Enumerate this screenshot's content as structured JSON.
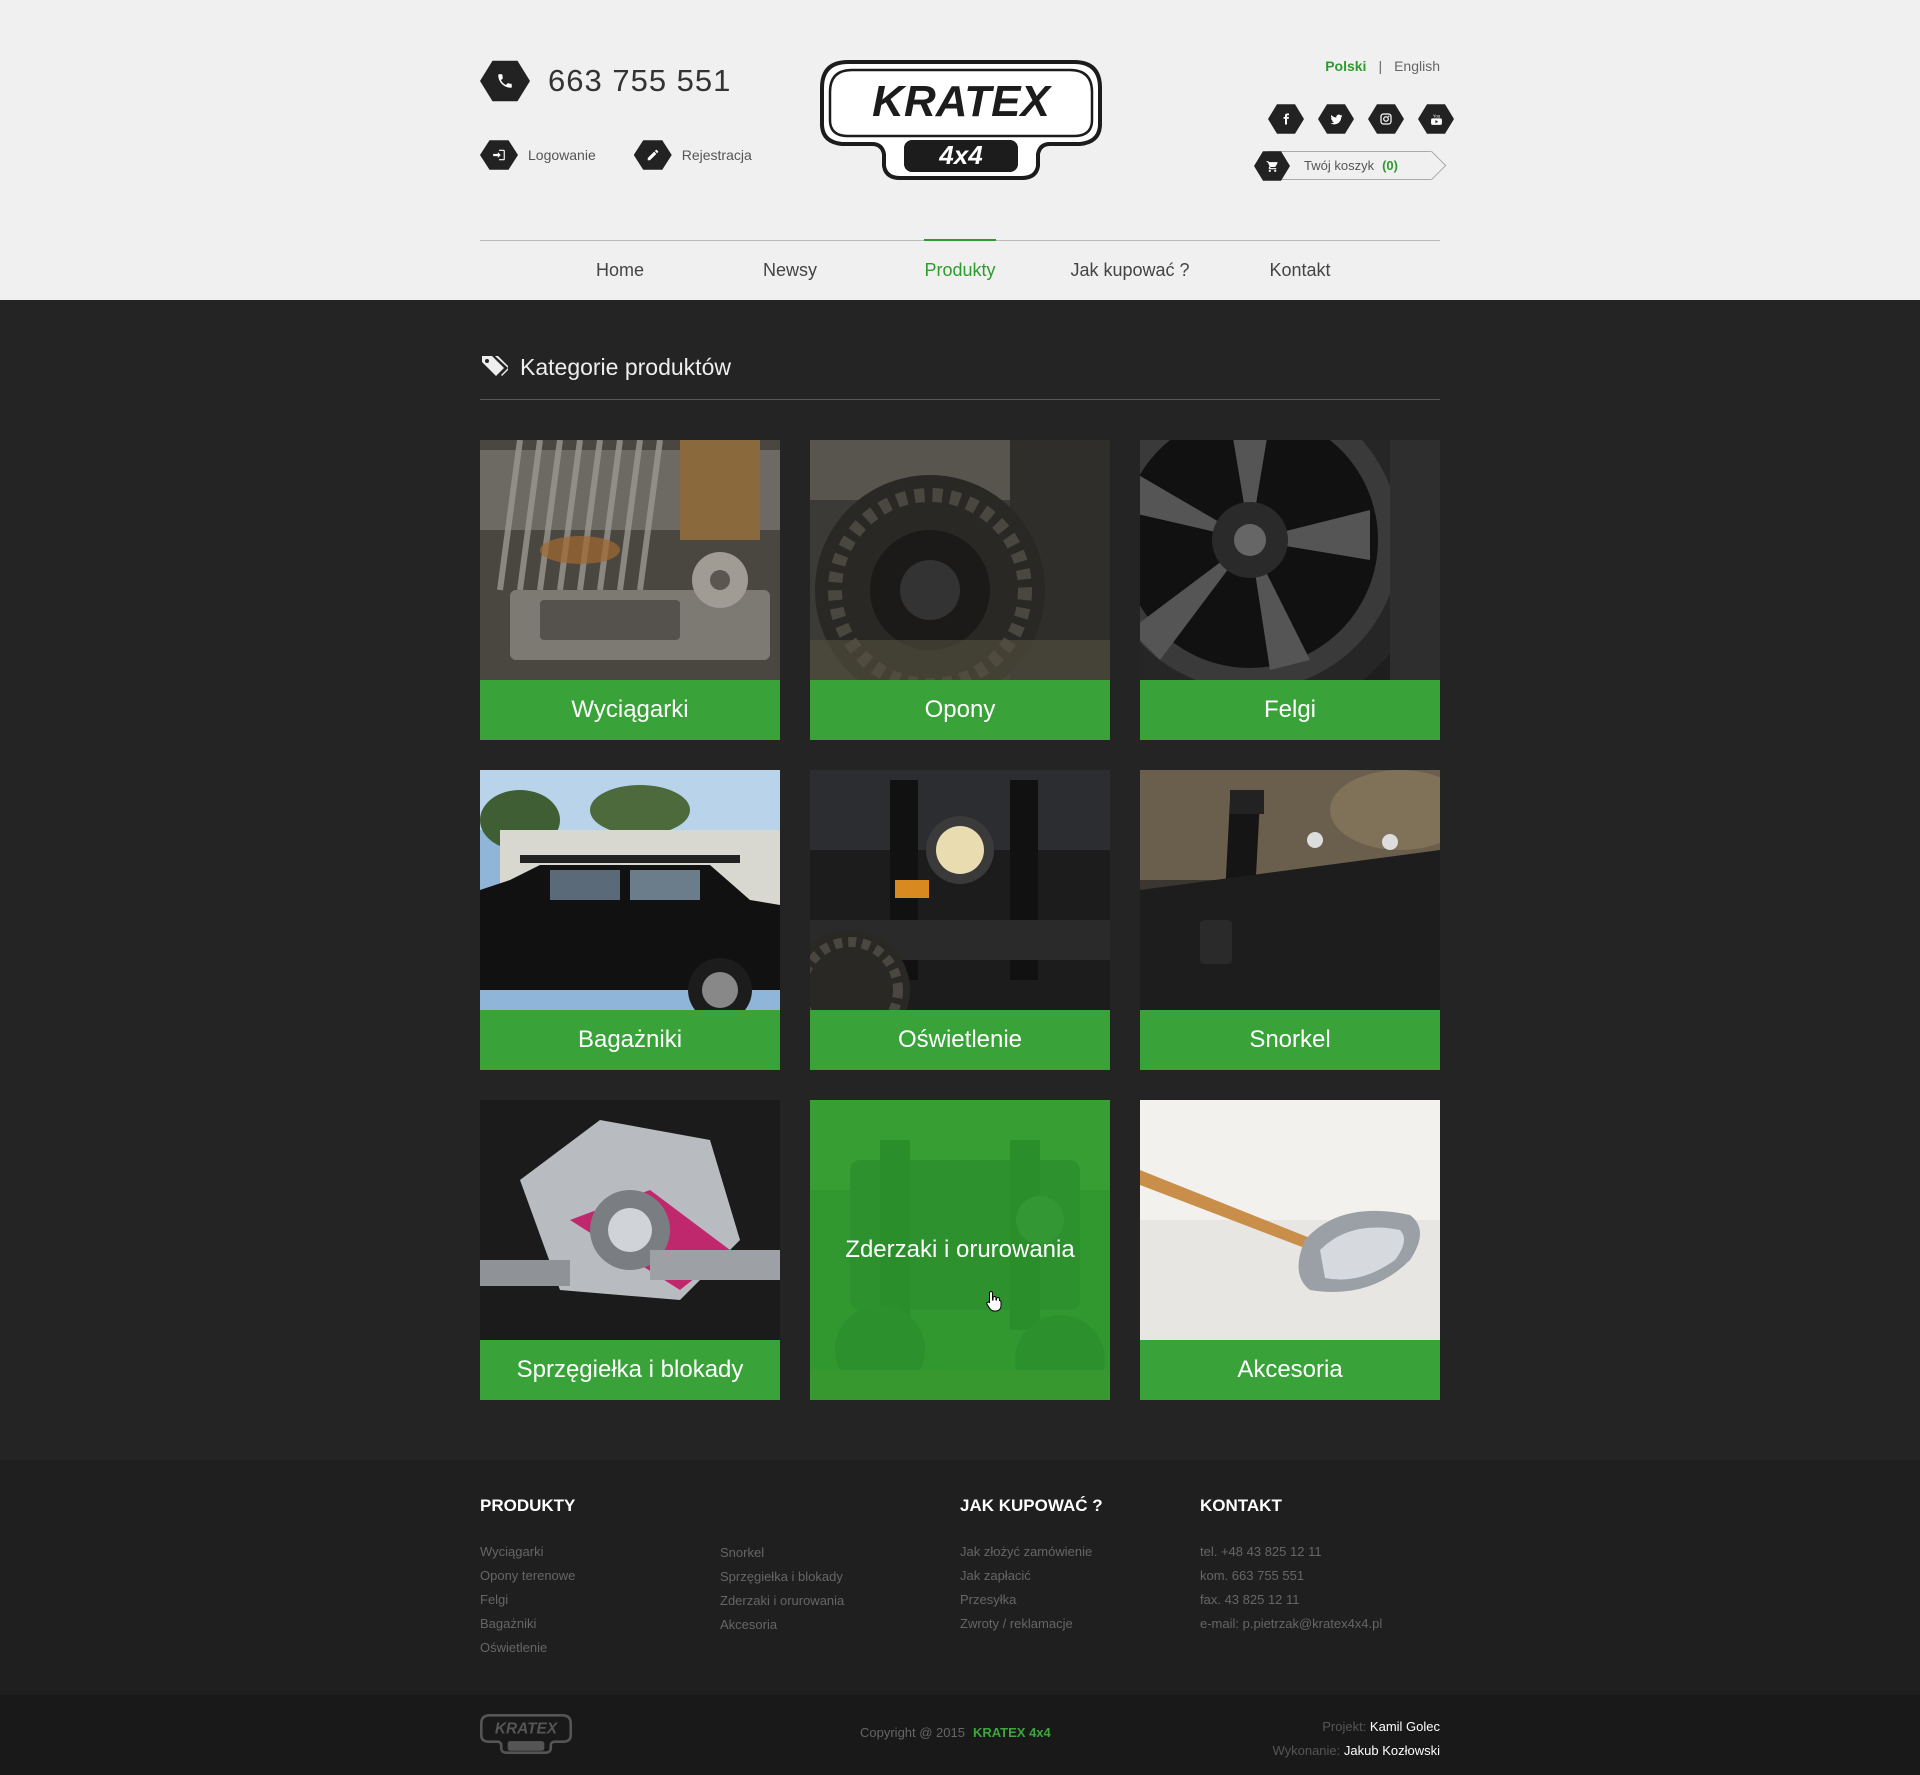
{
  "header": {
    "phone": "663  755  551",
    "auth": [
      {
        "label": "Logowanie",
        "icon": "login-icon"
      },
      {
        "label": "Rejestracja",
        "icon": "edit-icon"
      }
    ],
    "logo_text": "KRATEX",
    "logo_sub": "4x4",
    "languages": {
      "active": "Polski",
      "other": "English",
      "separator": "|"
    },
    "social": [
      "facebook-icon",
      "twitter-icon",
      "instagram-icon",
      "youtube-icon"
    ],
    "cart": {
      "label": "Twój koszyk",
      "count": "(0)"
    }
  },
  "nav": {
    "items": [
      "Home",
      "Newsy",
      "Produkty",
      "Jak kupować ?",
      "Kontakt"
    ],
    "active": "Produkty"
  },
  "section": {
    "title": "Kategorie produktów"
  },
  "categories": [
    {
      "label": "Wyciągarki"
    },
    {
      "label": "Opony"
    },
    {
      "label": "Felgi"
    },
    {
      "label": "Bagażniki"
    },
    {
      "label": "Oświetlenie"
    },
    {
      "label": "Snorkel"
    },
    {
      "label": "Sprzęgiełka i blokady"
    },
    {
      "label": "Zderzaki i orurowania"
    },
    {
      "label": "Akcesoria"
    }
  ],
  "footer": {
    "produkty": {
      "title": "PRODUKTY",
      "col1": [
        "Wyciągarki",
        "Opony terenowe",
        "Felgi",
        "Bagażniki",
        "Oświetlenie"
      ],
      "col2": [
        "Snorkel",
        "Sprzęgiełka i blokady",
        "Zderzaki i orurowania",
        "Akcesoria"
      ]
    },
    "jak": {
      "title": "JAK KUPOWAĆ ?",
      "items": [
        "Jak złożyć zamówienie",
        "Jak zapłacić",
        "Przesyłka",
        "Zwroty / reklamacje"
      ]
    },
    "kontakt": {
      "title": "KONTAKT",
      "items": [
        "tel. +48 43 825 12 11",
        "kom. 663 755 551",
        "fax. 43 825 12 11",
        "e-mail: p.pietrzak@kratex4x4.pl"
      ]
    }
  },
  "bottom": {
    "copyright": "Copyright @ 2015",
    "brand": "KRATEX 4x4",
    "projekt_label": "Projekt:",
    "projekt_name": "Kamil Golec",
    "wykonanie_label": "Wykonanie:",
    "wykonanie_name": "Jakub Kozłowski"
  },
  "colors": {
    "accent": "#39a33a",
    "header_bg": "#f0f0f0",
    "main_bg": "#242424",
    "footer_bg": "#1f1f1f"
  }
}
